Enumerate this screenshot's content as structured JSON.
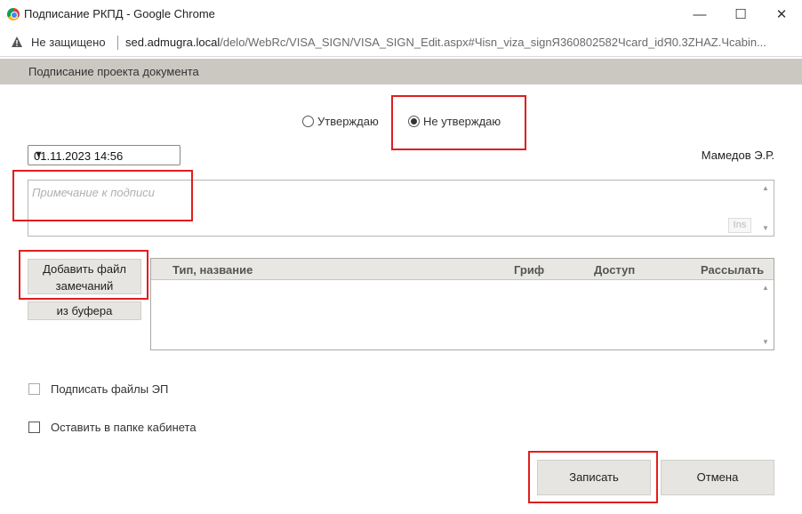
{
  "window": {
    "title": "Подписание РКПД - Google Chrome",
    "minimize_glyph": "—",
    "maximize_glyph": "☐",
    "close_glyph": "✕"
  },
  "address_bar": {
    "security_label": "Не защищено",
    "url_host": "sed.admugra.local",
    "url_path": "/delo/WebRc/VISA_SIGN/VISA_SIGN_Edit.aspx#Чisn_viza_signЯ360802582Чcard_idЯ0.3ZHAZ.Чcabin..."
  },
  "dialog": {
    "title": "Подписание проекта документа",
    "decision": {
      "options": [
        "Утверждаю",
        "Не утверждаю"
      ],
      "selected": "Не утверждаю"
    },
    "date_value": "01.11.2023 14:56",
    "signer_name": "Мамедов Э.Р.",
    "note_placeholder": "Примечание к подписи",
    "ins_label": "Ins",
    "add_file_label": "Добавить файл замечаний",
    "from_buffer_label": "из буфера",
    "files_table": {
      "columns": [
        "Тип, название",
        "Гриф",
        "Доступ",
        "Рассылать"
      ],
      "rows": []
    },
    "sign_files_label": "Подписать файлы ЭП",
    "sign_files_checked": false,
    "keep_in_folder_label": "Оставить в папке кабинета",
    "keep_in_folder_checked": false,
    "save_label": "Записать",
    "cancel_label": "Отмена"
  },
  "colors": {
    "highlight_red": "#e01e1e",
    "header_bg": "#cbc8c2",
    "button_bg": "#e6e5e1"
  }
}
